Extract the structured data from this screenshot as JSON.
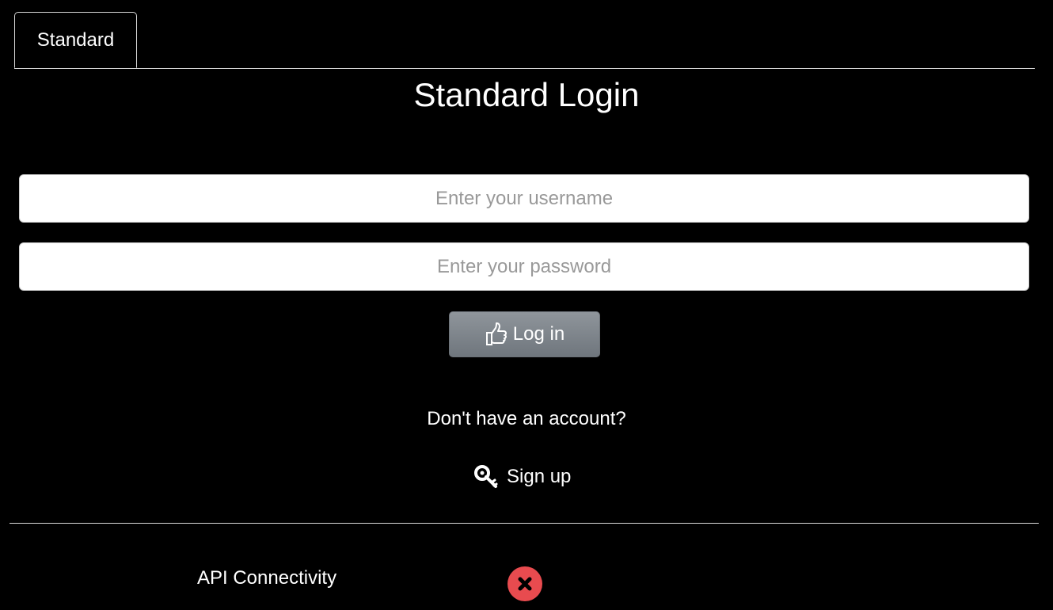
{
  "tabs": [
    {
      "label": "Standard",
      "active": true
    }
  ],
  "page_title": "Standard Login",
  "login_form": {
    "username_placeholder": "Enter your username",
    "password_placeholder": "Enter your password",
    "login_button_label": "Log in",
    "login_icon": "thumbs-up-icon"
  },
  "signup": {
    "prompt": "Don't have an account?",
    "link_label": "Sign up",
    "link_icon": "key-icon"
  },
  "status": {
    "api_label": "API Connectivity",
    "api_state_icon": "error-x-icon",
    "api_state_color": "#e84b4f"
  }
}
